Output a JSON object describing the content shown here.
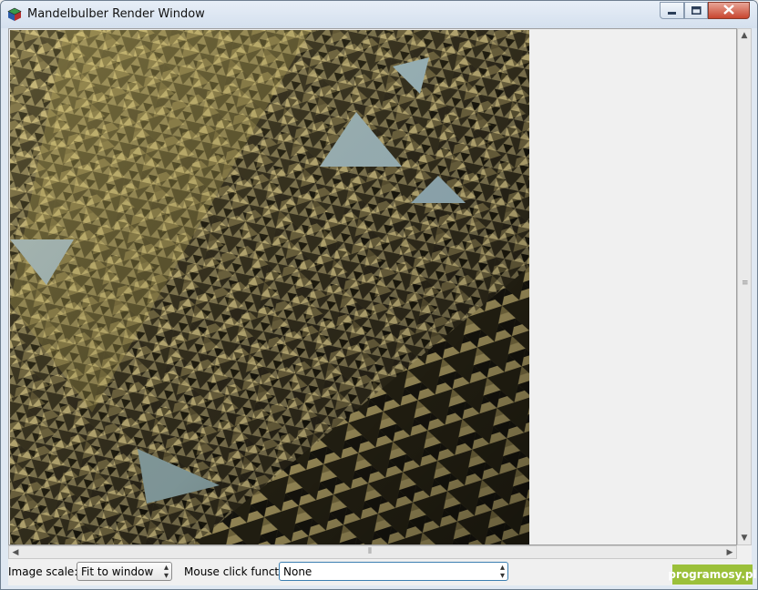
{
  "window": {
    "title": "Mandelbulber Render Window"
  },
  "controls": {
    "minimize": "minimize",
    "maximize": "maximize",
    "close": "close"
  },
  "bottom": {
    "image_scale_label": "Image scale:",
    "image_scale_value": "Fit to window",
    "mouse_click_label": "Mouse click function:",
    "mouse_click_value": "None"
  },
  "watermark": "programosy.pl",
  "icons": {
    "app": "mandelbulber-cube-icon",
    "minimize": "minimize-icon",
    "maximize": "maximize-icon",
    "close": "close-icon"
  }
}
